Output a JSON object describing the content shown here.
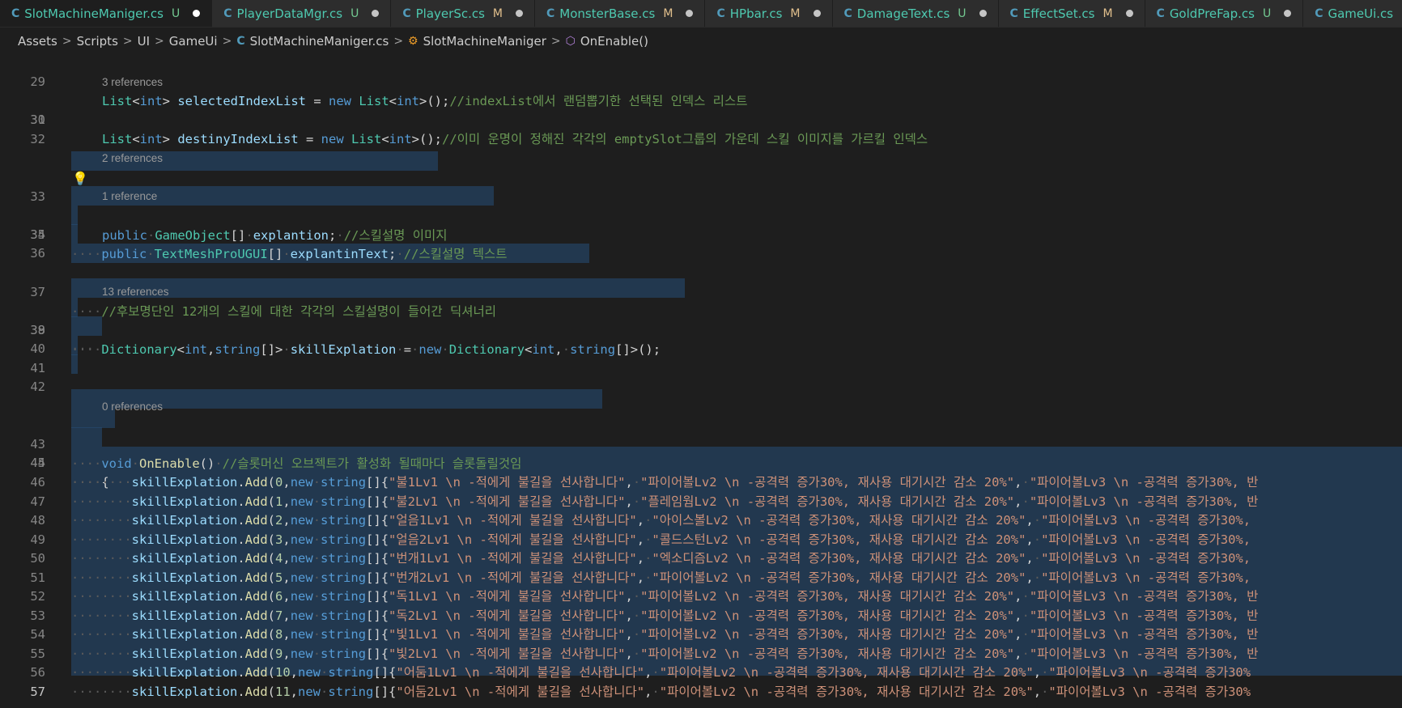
{
  "tabs": [
    {
      "name": "SlotMachineManiger.cs",
      "status": "U",
      "active": true
    },
    {
      "name": "PlayerDataMgr.cs",
      "status": "U",
      "active": false
    },
    {
      "name": "PlayerSc.cs",
      "status": "M",
      "active": false
    },
    {
      "name": "MonsterBase.cs",
      "status": "M",
      "active": false
    },
    {
      "name": "HPbar.cs",
      "status": "M",
      "active": false
    },
    {
      "name": "DamageText.cs",
      "status": "U",
      "active": false
    },
    {
      "name": "EffectSet.cs",
      "status": "M",
      "active": false
    },
    {
      "name": "GoldPreFap.cs",
      "status": "U",
      "active": false
    },
    {
      "name": "GameUi.cs",
      "status": "M",
      "active": false
    }
  ],
  "breadcrumb": {
    "assets": "Assets",
    "scripts": "Scripts",
    "ui": "UI",
    "gameui": "GameUi",
    "file": "SlotMachineManiger.cs",
    "cls": "SlotMachineManiger",
    "method": "OnEnable()"
  },
  "lenses": {
    "l30": "3 references",
    "l33": "2 references",
    "l34": "1 reference",
    "l38": "13 references",
    "l43": "0 references"
  },
  "code": {
    "l29_cmt": "//indexList에서 랜덤뽑기한 선택된 인덱스 리스트",
    "l30_cmt": "//이미 운명이 정해진 각각의 emptySlot그룹의 가운데 스킬 이미지를 가르킬 인덱스",
    "l33_cmt": "//스킬설명 이미지",
    "l34_cmt": "//스킬설명 텍스트",
    "l37_cmt": "//후보명단인 12개의 스킬에 대한 각각의 스킬설명이 들어간 딕셔너리",
    "l43_cmt": "//슬롯머신 오브젝트가 활성화 될때마다 슬롯돌릴것임"
  },
  "skills": [
    {
      "idx": "0",
      "s1": "\"불1Lv1 \\n -적에게 불길을 선사합니다\"",
      "s2": "\"파이어볼Lv2 \\n -공격력 증가30%, 재사용 대기시간 감소 20%\"",
      "s3": "\"파이어볼Lv3 \\n -공격력 증가30%, 반"
    },
    {
      "idx": "1",
      "s1": "\"불2Lv1 \\n -적에게 불길을 선사합니다\"",
      "s2": "\"플레임웜Lv2 \\n -공격력 증가30%, 재사용 대기시간 감소 20%\"",
      "s3": "\"파이어볼Lv3 \\n -공격력 증가30%, 반"
    },
    {
      "idx": "2",
      "s1": "\"얼음1Lv1 \\n -적에게 불길을 선사합니다\"",
      "s2": "\"아이스볼Lv2 \\n -공격력 증가30%, 재사용 대기시간 감소 20%\"",
      "s3": "\"파이어볼Lv3 \\n -공격력 증가30%,"
    },
    {
      "idx": "3",
      "s1": "\"얼음2Lv1 \\n -적에게 불길을 선사합니다\"",
      "s2": "\"콜드스턴Lv2 \\n -공격력 증가30%, 재사용 대기시간 감소 20%\"",
      "s3": "\"파이어볼Lv3 \\n -공격력 증가30%,"
    },
    {
      "idx": "4",
      "s1": "\"번개1Lv1 \\n -적에게 불길을 선사합니다\"",
      "s2": "\"엑소디즘Lv2 \\n -공격력 증가30%, 재사용 대기시간 감소 20%\"",
      "s3": "\"파이어볼Lv3 \\n -공격력 증가30%,"
    },
    {
      "idx": "5",
      "s1": "\"번개2Lv1 \\n -적에게 불길을 선사합니다\"",
      "s2": "\"파이어볼Lv2 \\n -공격력 증가30%, 재사용 대기시간 감소 20%\"",
      "s3": "\"파이어볼Lv3 \\n -공격력 증가30%,"
    },
    {
      "idx": "6",
      "s1": "\"독1Lv1 \\n -적에게 불길을 선사합니다\"",
      "s2": "\"파이어볼Lv2 \\n -공격력 증가30%, 재사용 대기시간 감소 20%\"",
      "s3": "\"파이어볼Lv3 \\n -공격력 증가30%, 반"
    },
    {
      "idx": "7",
      "s1": "\"독2Lv1 \\n -적에게 불길을 선사합니다\"",
      "s2": "\"파이어볼Lv2 \\n -공격력 증가30%, 재사용 대기시간 감소 20%\"",
      "s3": "\"파이어볼Lv3 \\n -공격력 증가30%, 반"
    },
    {
      "idx": "8",
      "s1": "\"빛1Lv1 \\n -적에게 불길을 선사합니다\"",
      "s2": "\"파이어볼Lv2 \\n -공격력 증가30%, 재사용 대기시간 감소 20%\"",
      "s3": "\"파이어볼Lv3 \\n -공격력 증가30%, 반"
    },
    {
      "idx": "9",
      "s1": "\"빛2Lv1 \\n -적에게 불길을 선사합니다\"",
      "s2": "\"파이어볼Lv2 \\n -공격력 증가30%, 재사용 대기시간 감소 20%\"",
      "s3": "\"파이어볼Lv3 \\n -공격력 증가30%, 반"
    },
    {
      "idx": "10",
      "s1": "\"어둠1Lv1 \\n -적에게 불길을 선사합니다\"",
      "s2": "\"파이어볼Lv2 \\n -공격력 증가30%, 재사용 대기시간 감소 20%\"",
      "s3": "\"파이어볼Lv3 \\n -공격력 증가30%"
    },
    {
      "idx": "11",
      "s1": "\"어둠2Lv1 \\n -적에게 불길을 선사합니다\"",
      "s2": "\"파이어볼Lv2 \\n -공격력 증가30%, 재사용 대기시간 감소 20%\"",
      "s3": "\"파이어볼Lv3 \\n -공격력 증가30%"
    }
  ],
  "line_numbers": [
    "29",
    "30",
    "31",
    "32",
    "33",
    "34",
    "35",
    "36",
    "37",
    "38",
    "39",
    "40",
    "41",
    "42",
    "43",
    "44",
    "45",
    "46",
    "47",
    "48",
    "49",
    "50",
    "51",
    "52",
    "53",
    "54",
    "55",
    "56",
    "57"
  ]
}
